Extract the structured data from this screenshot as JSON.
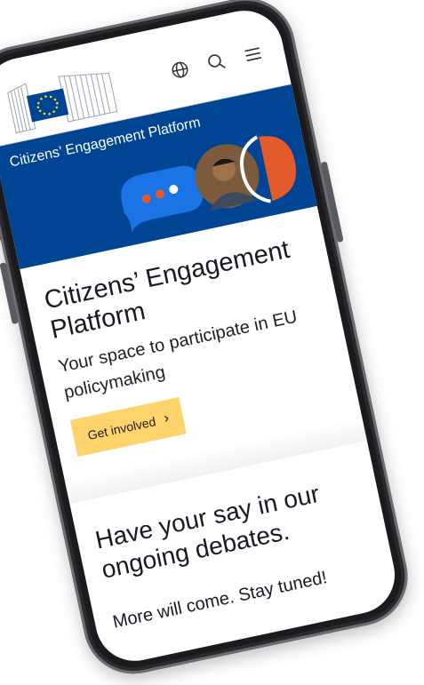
{
  "header": {
    "language_icon": "globe-icon",
    "search_icon": "search-icon",
    "menu_icon": "hamburger-menu-icon",
    "logo_icon": "eu-commission-logo"
  },
  "banner": {
    "title": "Citizens’ Engagement Platform",
    "background_color": "#004494"
  },
  "hero": {
    "title": "Citizens’ Engagement Platform",
    "subtitle": "Your space to participate in EU policymaking",
    "cta_label": "Get involved",
    "cta_color": "#ffd36b"
  },
  "debates": {
    "title": "Have your say in our ongoing debates.",
    "note": "More will come. Stay tuned!"
  },
  "colors": {
    "accent_orange": "#e35a2b",
    "eu_blue": "#004494",
    "eu_yellow": "#ffd617"
  }
}
